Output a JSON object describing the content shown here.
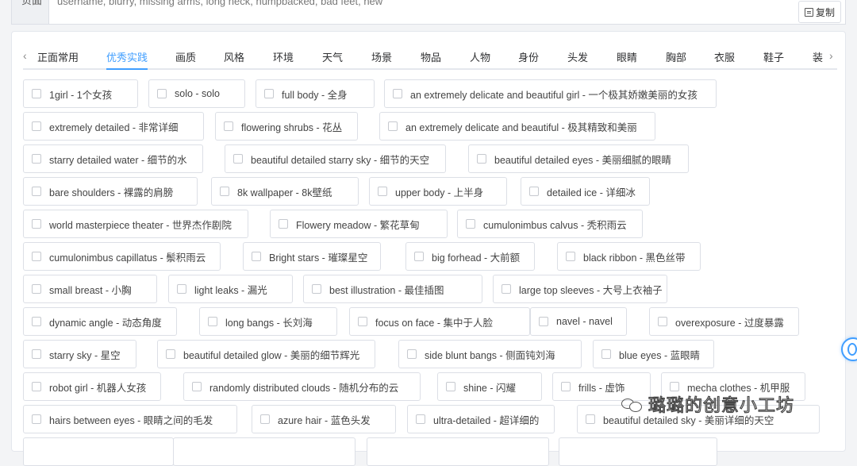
{
  "negative_prompt": {
    "label": "负面",
    "value": "username, blurry, missing arms, long neck, humpbacked, bad feet, new",
    "copy_label": "复制"
  },
  "tabs": [
    "正面常用",
    "优秀实践",
    "画质",
    "风格",
    "环境",
    "天气",
    "场景",
    "物品",
    "人物",
    "身份",
    "头发",
    "眼睛",
    "胸部",
    "衣服",
    "鞋子",
    "装"
  ],
  "active_tab": "优秀实践",
  "tags": [
    "1girl - 1个女孩",
    "solo - solo",
    "full body - 全身",
    "an extremely delicate and beautiful girl - 一个极其娇嫩美丽的女孩",
    "extremely detailed - 非常详细",
    "flowering shrubs - 花丛",
    "an extremely delicate and beautiful - 极其精致和美丽",
    "starry detailed water - 细节的水",
    "beautiful detailed starry sky - 细节的天空",
    "beautiful detailed eyes - 美丽细腻的眼睛",
    "bare shoulders - 裸露的肩膀",
    "8k wallpaper - 8k壁纸",
    "upper body - 上半身",
    "detailed ice - 详细冰",
    "world masterpiece theater - 世界杰作剧院",
    "Flowery meadow - 繁花草甸",
    "cumulonimbus calvus - 秃积雨云",
    "cumulonimbus capillatus - 鬃积雨云",
    "Bright stars - 璀璨星空",
    "big forhead - 大前额",
    "black ribbon - 黑色丝带",
    "small breast - 小胸",
    "light leaks - 漏光",
    "best illustration - 最佳插图",
    "large top sleeves - 大号上衣袖子",
    "dynamic angle - 动态角度",
    "long bangs - 长刘海",
    "focus on face - 集中于人脸",
    "navel - navel",
    "overexposure - 过度暴露",
    "starry sky - 星空",
    "beautiful detailed glow - 美丽的细节辉光",
    "side blunt bangs - 侧面钝刘海",
    "blue eyes - 蓝眼睛",
    "robot girl - 机器人女孩",
    "randomly distributed clouds - 随机分布的云",
    "shine - 闪耀",
    "frills - 虚饰",
    "mecha clothes - 机甲服",
    "hairs between eyes - 眼睛之间的毛发",
    "azure hair - 蓝色头发",
    "ultra-detailed - 超详细的",
    "beautiful detailed sky - 美丽详细的天空"
  ],
  "watermark": "璐璐的创意小工坊",
  "colors": {
    "accent": "#409eff",
    "border": "#dcdfe6",
    "text": "#444444"
  }
}
